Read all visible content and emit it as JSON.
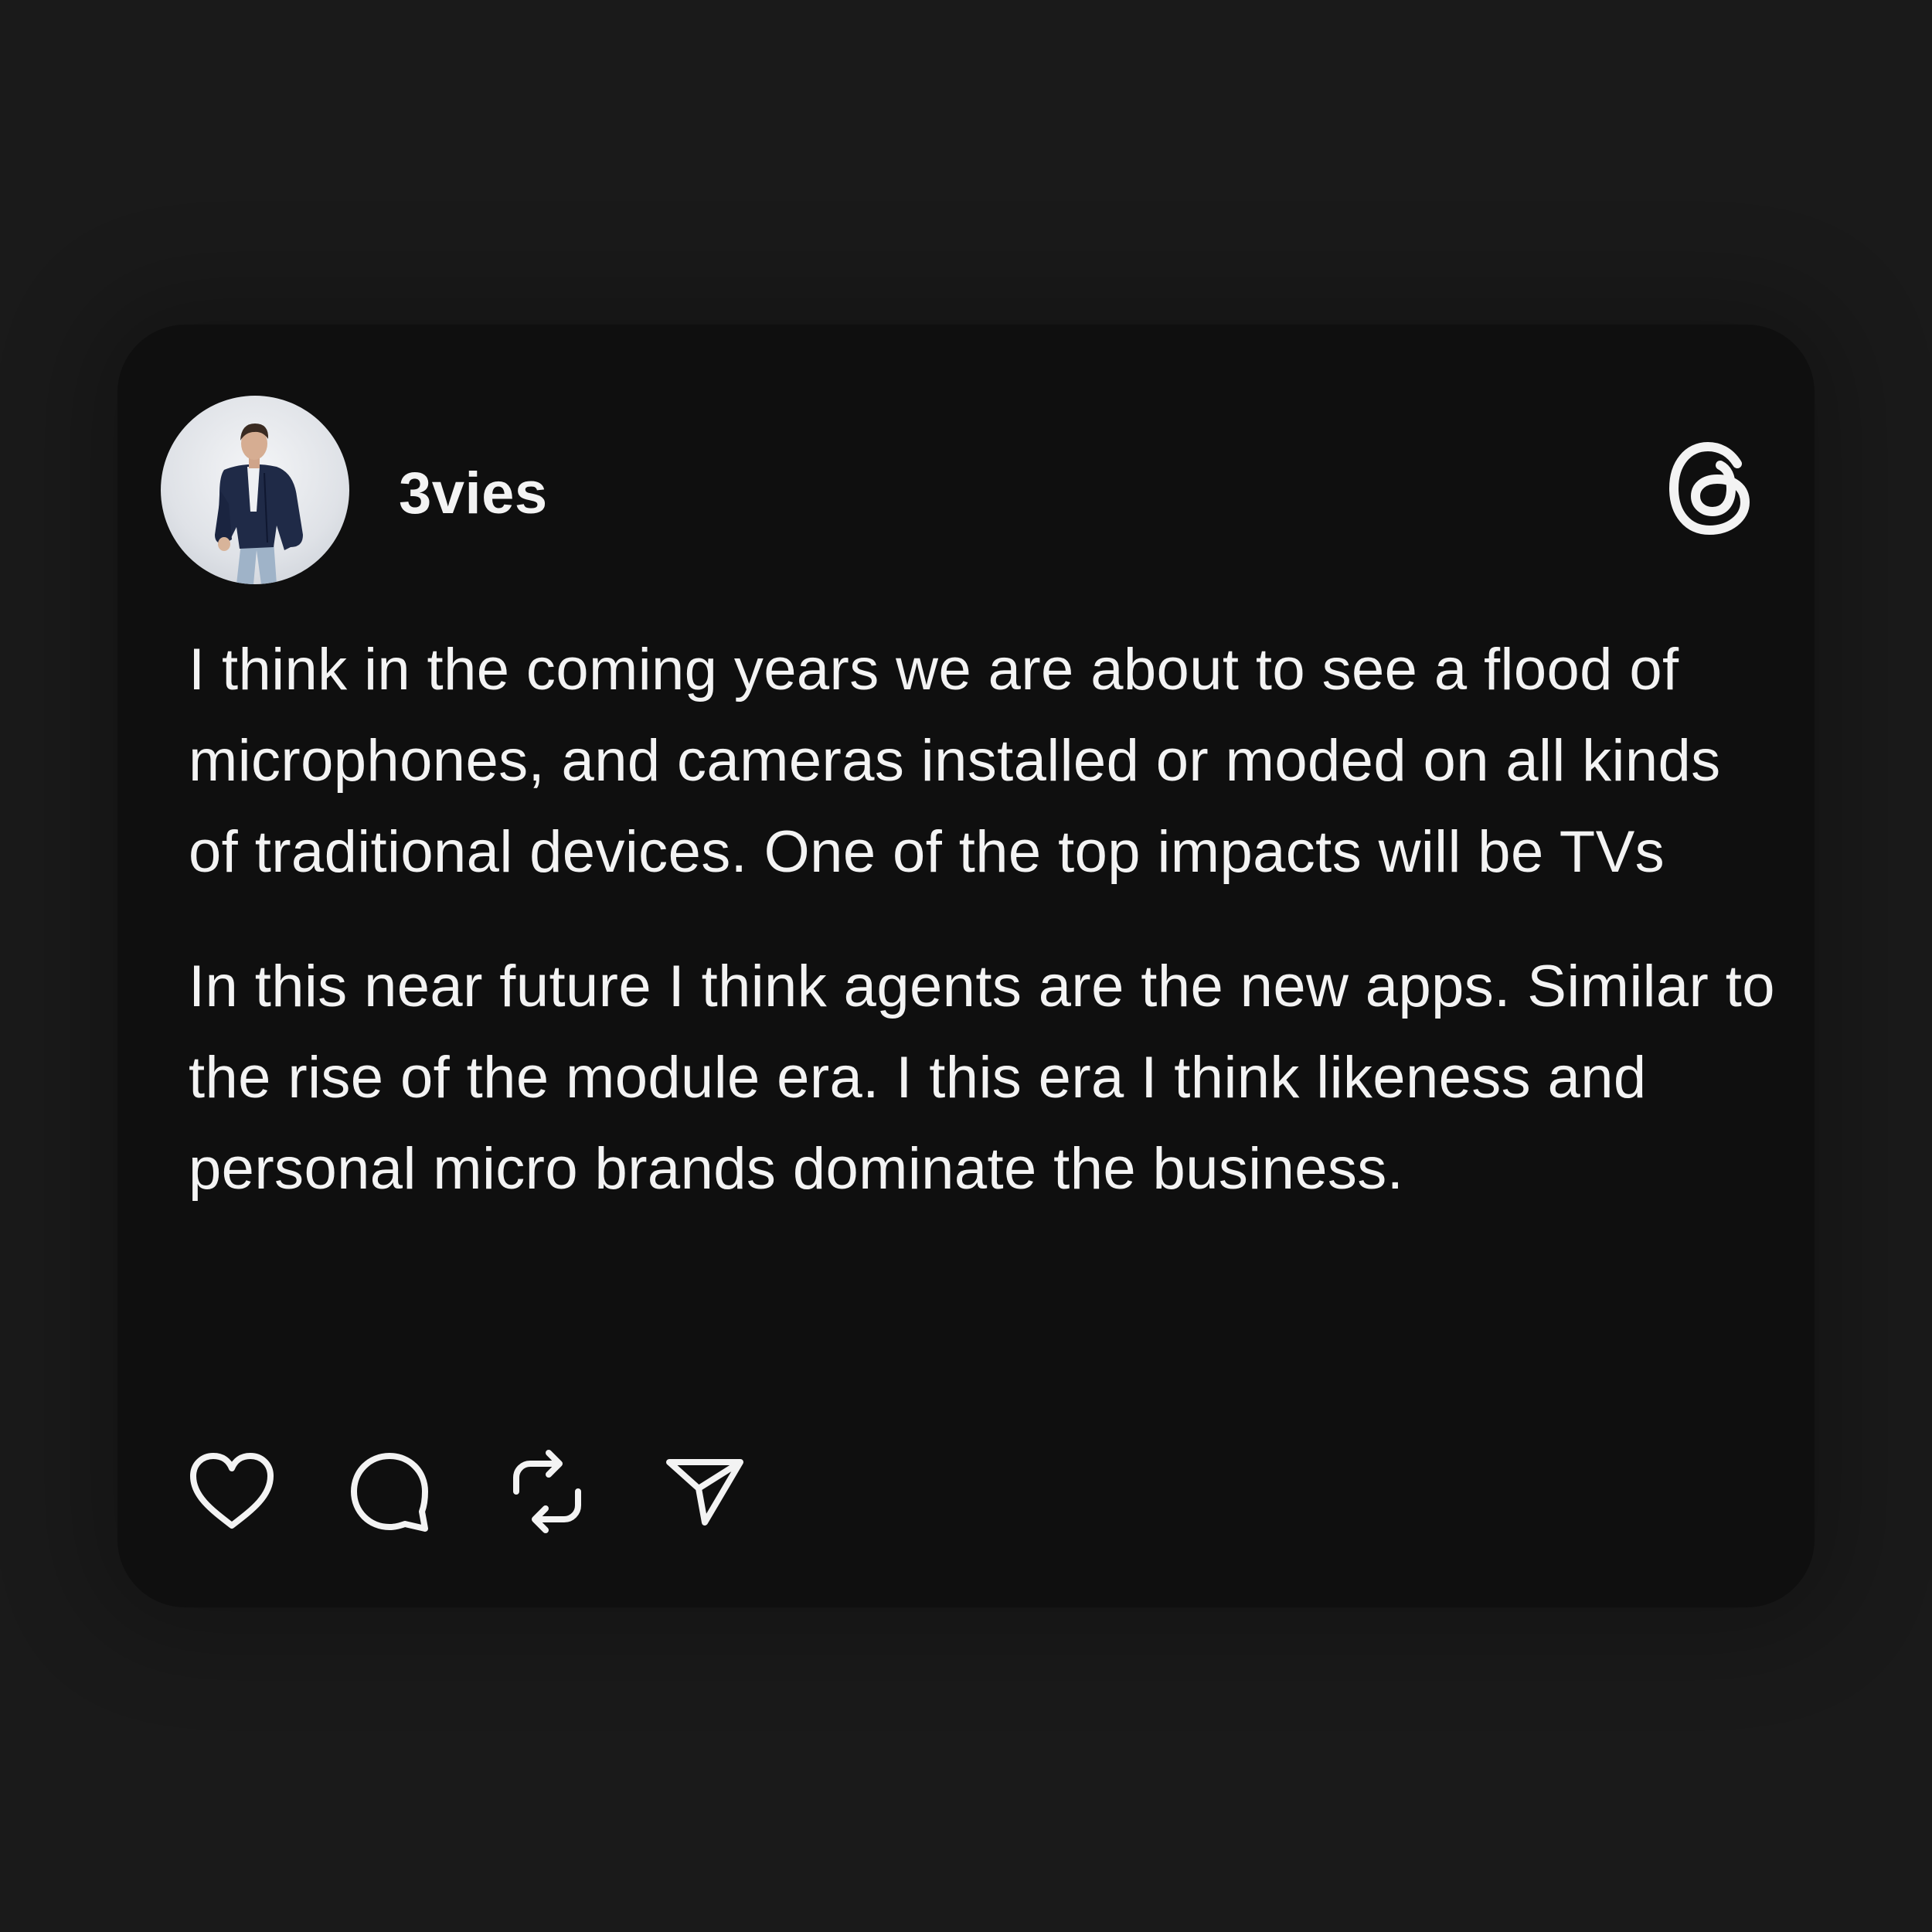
{
  "post": {
    "username": "3vies",
    "avatar_icon": "person-photo",
    "platform_icon": "threads-logo-icon",
    "paragraphs": [
      "I think in the coming years we are about to see a flood of microphones, and cameras installed or moded on all kinds of traditional devices. One of the top impacts will be TVs",
      "In this near future I think agents are the new apps. Similar to the rise of the module era. I this era I think likeness and personal micro brands dominate the business."
    ]
  },
  "actions": [
    {
      "icon": "heart-icon"
    },
    {
      "icon": "comment-icon"
    },
    {
      "icon": "repost-icon"
    },
    {
      "icon": "share-icon"
    }
  ],
  "colors": {
    "background": "#1a1a1a",
    "card": "#0f0f0f",
    "text": "#f3f3f3"
  }
}
